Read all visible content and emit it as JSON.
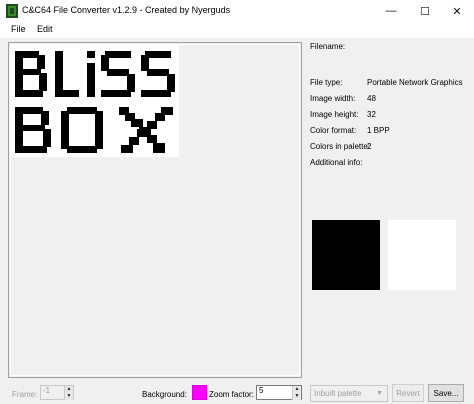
{
  "window": {
    "title": "C&C64 File Converter v1.2.9 - Created by Nyerguds",
    "minimize": "—",
    "maximize": "☐",
    "close": "✕"
  },
  "menu": {
    "file": "File",
    "edit": "Edit"
  },
  "info": {
    "filename_label": "Filename:",
    "filename_value": "",
    "file_type_label": "File type:",
    "file_type_value": "Portable Network Graphics",
    "width_label": "Image width:",
    "width_value": "48",
    "height_label": "Image height:",
    "height_value": "32",
    "color_format_label": "Color format:",
    "color_format_value": "1 BPP",
    "colors_label": "Colors in palette:",
    "colors_value": "2",
    "additional_label": "Additional info:"
  },
  "palette_colors": [
    "#000000",
    "#ffffff"
  ],
  "image_text": [
    "BLISS",
    "BOX"
  ],
  "bottom": {
    "frame_label": "Frame:",
    "frame_value": "-1",
    "background_label": "Background:",
    "background_color": "#ff00ff",
    "zoom_label": "Zoom factor:",
    "zoom_value": "5",
    "palette_select_value": "Inbuilt palette",
    "revert_label": "Revert",
    "save_label": "Save..."
  },
  "icons": {
    "app": "app-icon",
    "spin_up": "spin-up-icon",
    "spin_down": "spin-down-icon",
    "dropdown": "chevron-down-icon"
  }
}
